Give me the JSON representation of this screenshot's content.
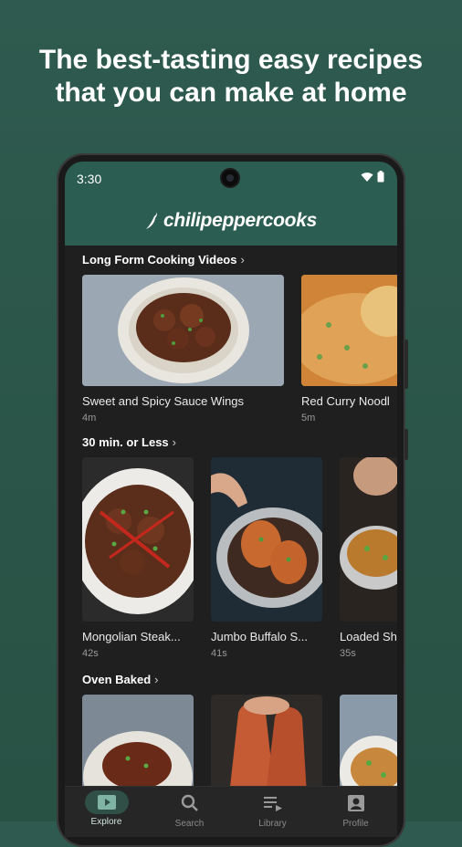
{
  "headline": {
    "line1": "The best-tasting easy recipes",
    "line2": "that you can make at home"
  },
  "status": {
    "time": "3:30"
  },
  "app": {
    "logo_text": "chilipeppercooks",
    "brand_color": "#2c5d52"
  },
  "sections": [
    {
      "title": "Long Form Cooking Videos",
      "items": [
        {
          "title": "Sweet and Spicy Sauce Wings",
          "duration": "4m"
        },
        {
          "title": "Red Curry Noodl",
          "duration": "5m"
        }
      ]
    },
    {
      "title": "30 min. or Less",
      "items": [
        {
          "title": "Mongolian Steak...",
          "duration": "42s"
        },
        {
          "title": "Jumbo Buffalo S...",
          "duration": "41s"
        },
        {
          "title": "Loaded Sh",
          "duration": "35s"
        }
      ]
    },
    {
      "title": "Oven Baked",
      "items": [
        {},
        {},
        {}
      ]
    }
  ],
  "nav": [
    {
      "label": "Explore",
      "icon": "play-box-icon",
      "active": true
    },
    {
      "label": "Search",
      "icon": "search-icon"
    },
    {
      "label": "Library",
      "icon": "playlist-icon"
    },
    {
      "label": "Profile",
      "icon": "account-box-icon"
    }
  ]
}
